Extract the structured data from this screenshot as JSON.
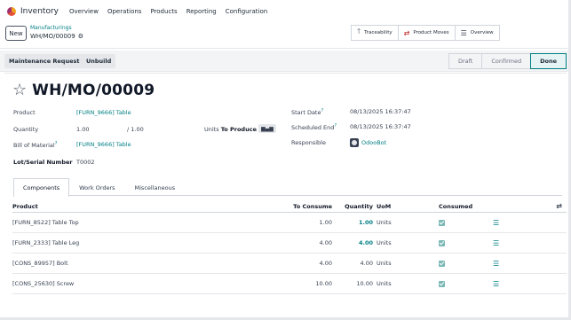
{
  "navbar": {
    "app_name": "Inventory",
    "menu": [
      "Overview",
      "Operations",
      "Products",
      "Reporting",
      "Configuration"
    ]
  },
  "control_panel": {
    "new_label": "New",
    "breadcrumb_parent": "Manufacturings",
    "breadcrumb_current": "WH/MO/00009",
    "smart_buttons": [
      {
        "icon": "arrow-up-icon",
        "label": "Traceability"
      },
      {
        "icon": "swap-arrows-icon",
        "label": "Product Moves"
      },
      {
        "icon": "list-icon",
        "label": "Overview"
      }
    ]
  },
  "actions": {
    "maintenance_request": "Maintenance Request",
    "unbuild": "Unbuild"
  },
  "status": {
    "stages": [
      "Draft",
      "Confirmed",
      "Done"
    ],
    "active": "Done"
  },
  "form": {
    "title": "WH/MO/00009",
    "product_label": "Product",
    "product_value": "[FURN_9666] Table",
    "quantity_label": "Quantity",
    "quantity_value": "1.00",
    "quantity_total": "/ 1.00",
    "units_label": "Units",
    "to_produce_label": "To Produce",
    "bom_label": "Bill of Material",
    "bom_value": "[FURN_9666] Table",
    "lot_label": "Lot/Serial Number",
    "lot_value": "T0002",
    "start_date_label": "Start Date",
    "start_date_value": "08/13/2025 16:37:47",
    "scheduled_end_label": "Scheduled End",
    "scheduled_end_value": "08/13/2025 16:37:47",
    "responsible_label": "Responsible",
    "responsible_value": "OdooBot",
    "help_mark": "?"
  },
  "tabs": [
    "Components",
    "Work Orders",
    "Miscellaneous"
  ],
  "table": {
    "headers": {
      "product": "Product",
      "to_consume": "To Consume",
      "quantity": "Quantity",
      "uom": "UoM",
      "consumed": "Consumed"
    },
    "rows": [
      {
        "product": "[FURN_8522] Table Top",
        "to_consume": "1.00",
        "quantity": "1.00",
        "uom": "Units",
        "highlight": true
      },
      {
        "product": "[FURN_2333] Table Leg",
        "to_consume": "4.00",
        "quantity": "4.00",
        "uom": "Units",
        "highlight": true
      },
      {
        "product": "[CONS_89957] Bolt",
        "to_consume": "4.00",
        "quantity": "4.00",
        "uom": "Units",
        "highlight": false
      },
      {
        "product": "[CONS_25630] Screw",
        "to_consume": "10.00",
        "quantity": "10.00",
        "uom": "Units",
        "highlight": false
      }
    ]
  },
  "colors": {
    "accent": "#017e84",
    "checkbox": "#7ab8b5"
  }
}
